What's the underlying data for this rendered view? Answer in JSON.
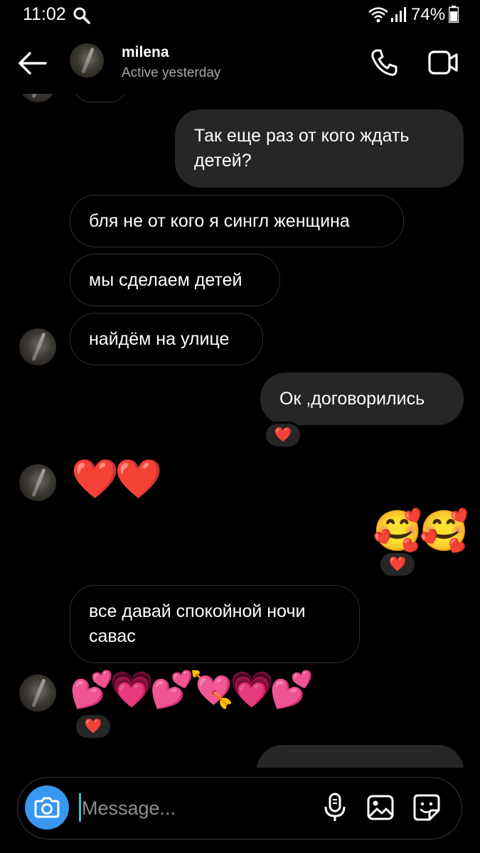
{
  "status_bar": {
    "time": "11:02",
    "battery": "74%"
  },
  "header": {
    "name": "milena",
    "status": "Active yesterday"
  },
  "messages": {
    "m1": "Так еще раз от кого ждать детей?",
    "m2": "бля не от кого я сингл женщина",
    "m3": "мы сделаем детей",
    "m4": "найдём на улице",
    "m5": "Ок ,договорились",
    "m6": "❤️❤️",
    "m7": "🥰🥰",
    "m8": "все давай спокойной ночи савас",
    "m9": "💕💗💕💘💗💕"
  },
  "reaction": "❤️",
  "composer": {
    "placeholder": "Message..."
  },
  "colors": {
    "background": "#000000",
    "outgoing_bubble": "#262626",
    "camera_button": "#3897f0",
    "cursor": "#3ec1c9"
  },
  "icons": [
    "search-icon",
    "wifi-icon",
    "signal-icon",
    "battery-icon",
    "back-arrow-icon",
    "phone-icon",
    "video-camera-icon",
    "camera-icon",
    "microphone-icon",
    "gallery-icon",
    "sticker-icon"
  ]
}
